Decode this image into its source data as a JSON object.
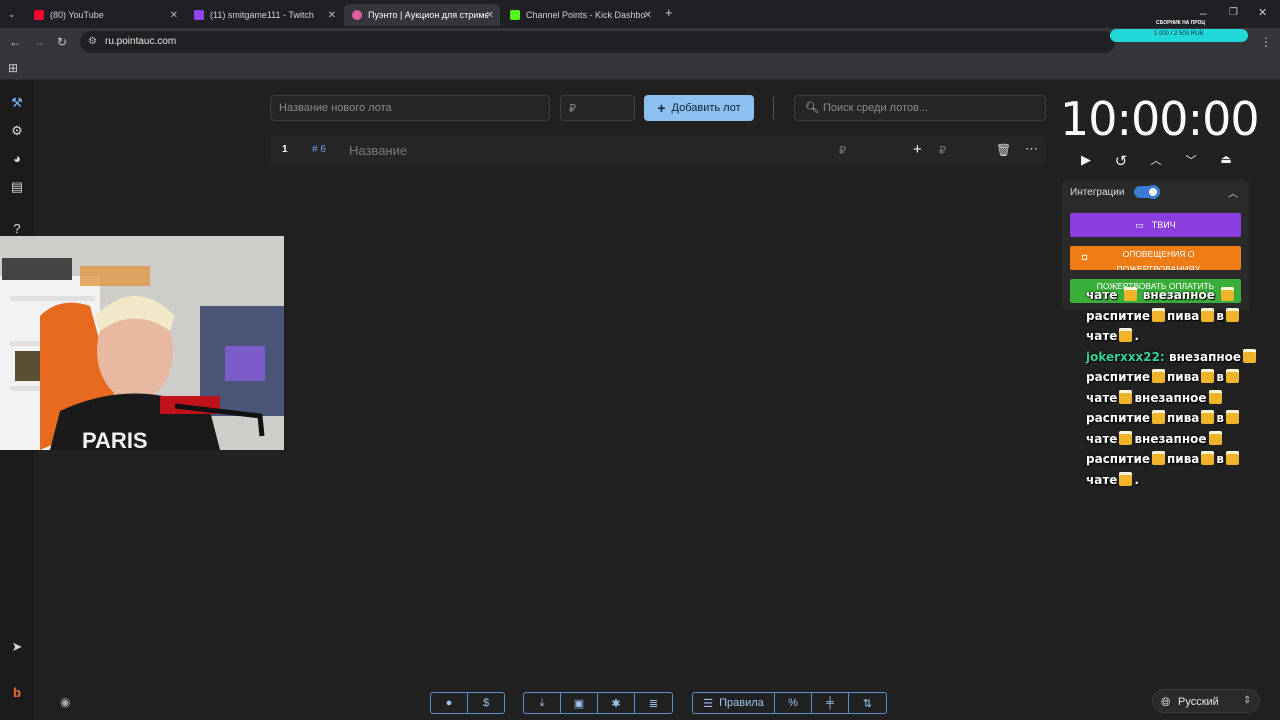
{
  "browser": {
    "tabs": [
      {
        "title": "(80) YouTube",
        "color": "#ff0033"
      },
      {
        "title": "(11) smitgame111 - Twitch",
        "color": "#9146ff"
      },
      {
        "title": "Пуэнто | Аукцион для стримеров",
        "color": "#e05fa0"
      },
      {
        "title": "Channel Points - Kick Dashboard",
        "color": "#53fc18"
      }
    ],
    "new_tab": "+",
    "url": "ru.pointauc.com"
  },
  "overlay_badge": {
    "top": "СБОРНИК НА ПРОЦ",
    "bottom": "2 000 / 2 500 RUB"
  },
  "toolbar": {
    "lot_name_placeholder": "Название нового лота",
    "amount_placeholder": "₽",
    "add_lot_label": "Добавить лот",
    "search_placeholder": "Поиск среди лотов..."
  },
  "lot": {
    "index": "1",
    "id": "# 6",
    "name_placeholder": "Название",
    "amount": "₽",
    "extra_amount": "₽"
  },
  "timer": {
    "value": "10:00:00"
  },
  "integrations": {
    "title": "Интеграции",
    "enabled": true,
    "buttons": [
      {
        "label": "ТВИЧ",
        "color": "#8a3ee0"
      },
      {
        "label": "ОПОВЕЩЕНИЯ О ПОЖЕРТВОВАНИЯХ",
        "color": "#f07c14"
      },
      {
        "label": "ПОЖЕРТВОВАТЬ ОПЛАТИТЬ",
        "color": "#3aae3a"
      }
    ]
  },
  "chat": {
    "line1": "чате",
    "word_vnez": "внезапное",
    "word_raspitie": "распитие",
    "word_piva": "пива",
    "word_v": "в",
    "word_chate": "чате",
    "dot": ".",
    "username": "jokerxxx22:"
  },
  "bottom": {
    "rules_label": "Правила",
    "language": "Русский"
  }
}
